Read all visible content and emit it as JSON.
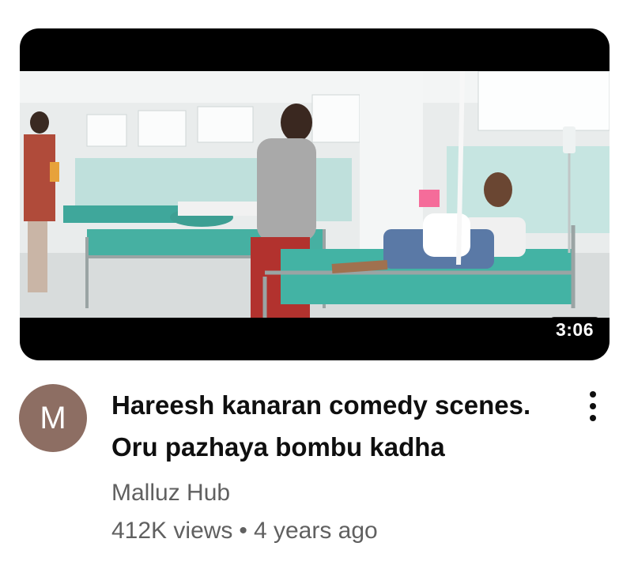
{
  "video": {
    "duration": "3:06",
    "title": "Hareesh kanaran comedy scenes. Oru pazhaya bombu kadha",
    "channel_name": "Malluz Hub",
    "channel_initial": "M",
    "views": "412K views",
    "separator": "•",
    "age": "4 years ago"
  },
  "icons": {
    "more": "more-vert-icon"
  },
  "colors": {
    "avatar_bg": "#8d6e63",
    "title_text": "#0f0f0f",
    "secondary_text": "#606060",
    "thumbnail_frame": "#000000"
  }
}
